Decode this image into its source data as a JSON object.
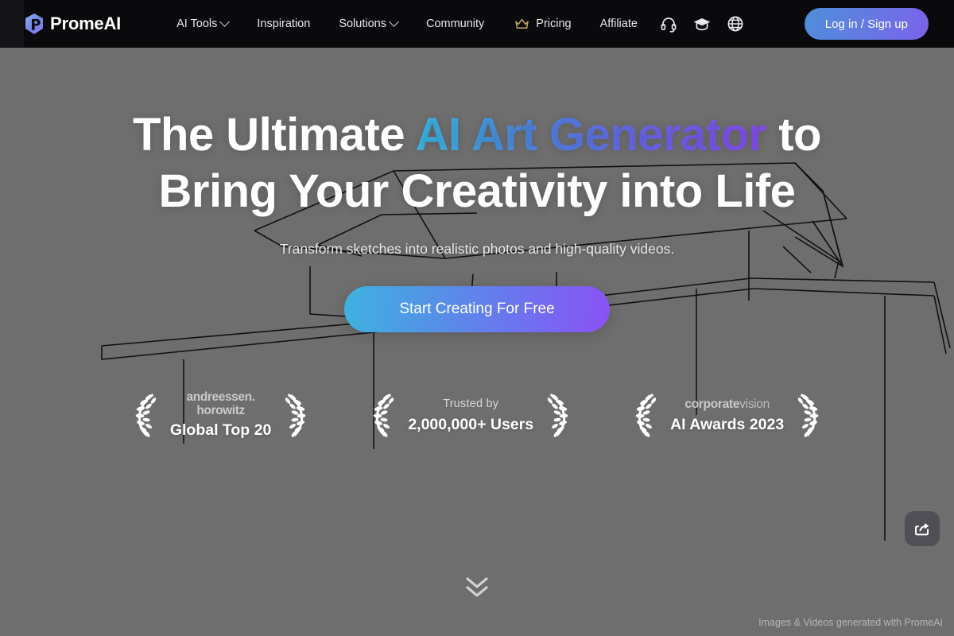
{
  "header": {
    "logo": {
      "icon": "promeai-cube-logo-icon",
      "text": "PromeAI"
    },
    "nav": [
      {
        "label": "AI Tools",
        "has_caret": true
      },
      {
        "label": "Inspiration",
        "has_caret": false
      },
      {
        "label": "Solutions",
        "has_caret": true
      },
      {
        "label": "Community",
        "has_caret": false
      },
      {
        "label": "Pricing",
        "has_caret": false,
        "icon": "crown-icon"
      },
      {
        "label": "Affiliate",
        "has_caret": false
      }
    ],
    "icons": [
      {
        "name": "headset-support-icon"
      },
      {
        "name": "graduation-cap-icon"
      },
      {
        "name": "globe-language-icon"
      }
    ],
    "login_label": "Log in / Sign up",
    "colors": {
      "bar_background": "#0a0a0c",
      "login_gradient_start": "#4f8ddb",
      "login_gradient_end": "#7a63ea",
      "crown": "#c9a45c"
    }
  },
  "hero": {
    "headline_part1": "The Ultimate ",
    "headline_gradient": "AI Art Generator",
    "headline_part2": " to",
    "headline_line2": "Bring Your Creativity into Life",
    "subtitle": "Transform sketches into realistic photos and high-quality videos.",
    "cta_label": "Start Creating For Free",
    "colors": {
      "background": "#6e6e6e",
      "gradient_start": "#3cc0f0",
      "gradient_mid": "#6b6cf0",
      "gradient_end": "#8a4ff7",
      "sketch_line": "#111111"
    }
  },
  "badges": [
    {
      "left_icon": "laurel-wreath-left-icon",
      "right_icon": "laurel-wreath-right-icon",
      "logo_line1": "andreessen.",
      "logo_line2": "horowitz",
      "title": "Global Top 20"
    },
    {
      "left_icon": "laurel-wreath-left-icon",
      "right_icon": "laurel-wreath-right-icon",
      "sub": "Trusted by",
      "title": "2,000,000+ Users"
    },
    {
      "left_icon": "laurel-wreath-left-icon",
      "right_icon": "laurel-wreath-right-icon",
      "logo_bold": "corporate",
      "logo_light": "vision",
      "title": "AI Awards 2023"
    }
  ],
  "floating": {
    "share_icon": "share-export-icon",
    "scroll_icon": "double-chevron-down-icon"
  },
  "footer": {
    "note": "Images & Videos generated with PromeAI"
  }
}
